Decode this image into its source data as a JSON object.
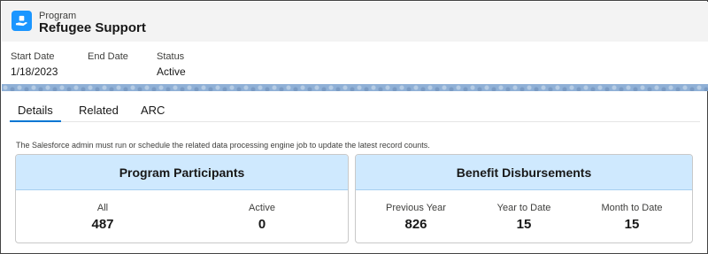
{
  "header": {
    "object_label": "Program",
    "record_title": "Refugee Support",
    "icon": "program-hand-box-icon"
  },
  "highlights": [
    {
      "label": "Start Date",
      "value": "1/18/2023"
    },
    {
      "label": "End Date",
      "value": ""
    },
    {
      "label": "Status",
      "value": "Active"
    }
  ],
  "tabs": [
    {
      "label": "Details",
      "active": true
    },
    {
      "label": "Related",
      "active": false
    },
    {
      "label": "ARC",
      "active": false
    }
  ],
  "notice": "The Salesforce admin must run or schedule the related data processing engine job to update the latest record counts.",
  "cards": {
    "participants": {
      "title": "Program Participants",
      "metrics": [
        {
          "label": "All",
          "value": "487"
        },
        {
          "label": "Active",
          "value": "0"
        }
      ]
    },
    "disbursements": {
      "title": "Benefit Disbursements",
      "metrics": [
        {
          "label": "Previous Year",
          "value": "826"
        },
        {
          "label": "Year to Date",
          "value": "15"
        },
        {
          "label": "Month to Date",
          "value": "15"
        }
      ]
    }
  },
  "colors": {
    "accent": "#0176d3",
    "icon_bg": "#1b96ff",
    "card_header": "#cfe9fe"
  }
}
